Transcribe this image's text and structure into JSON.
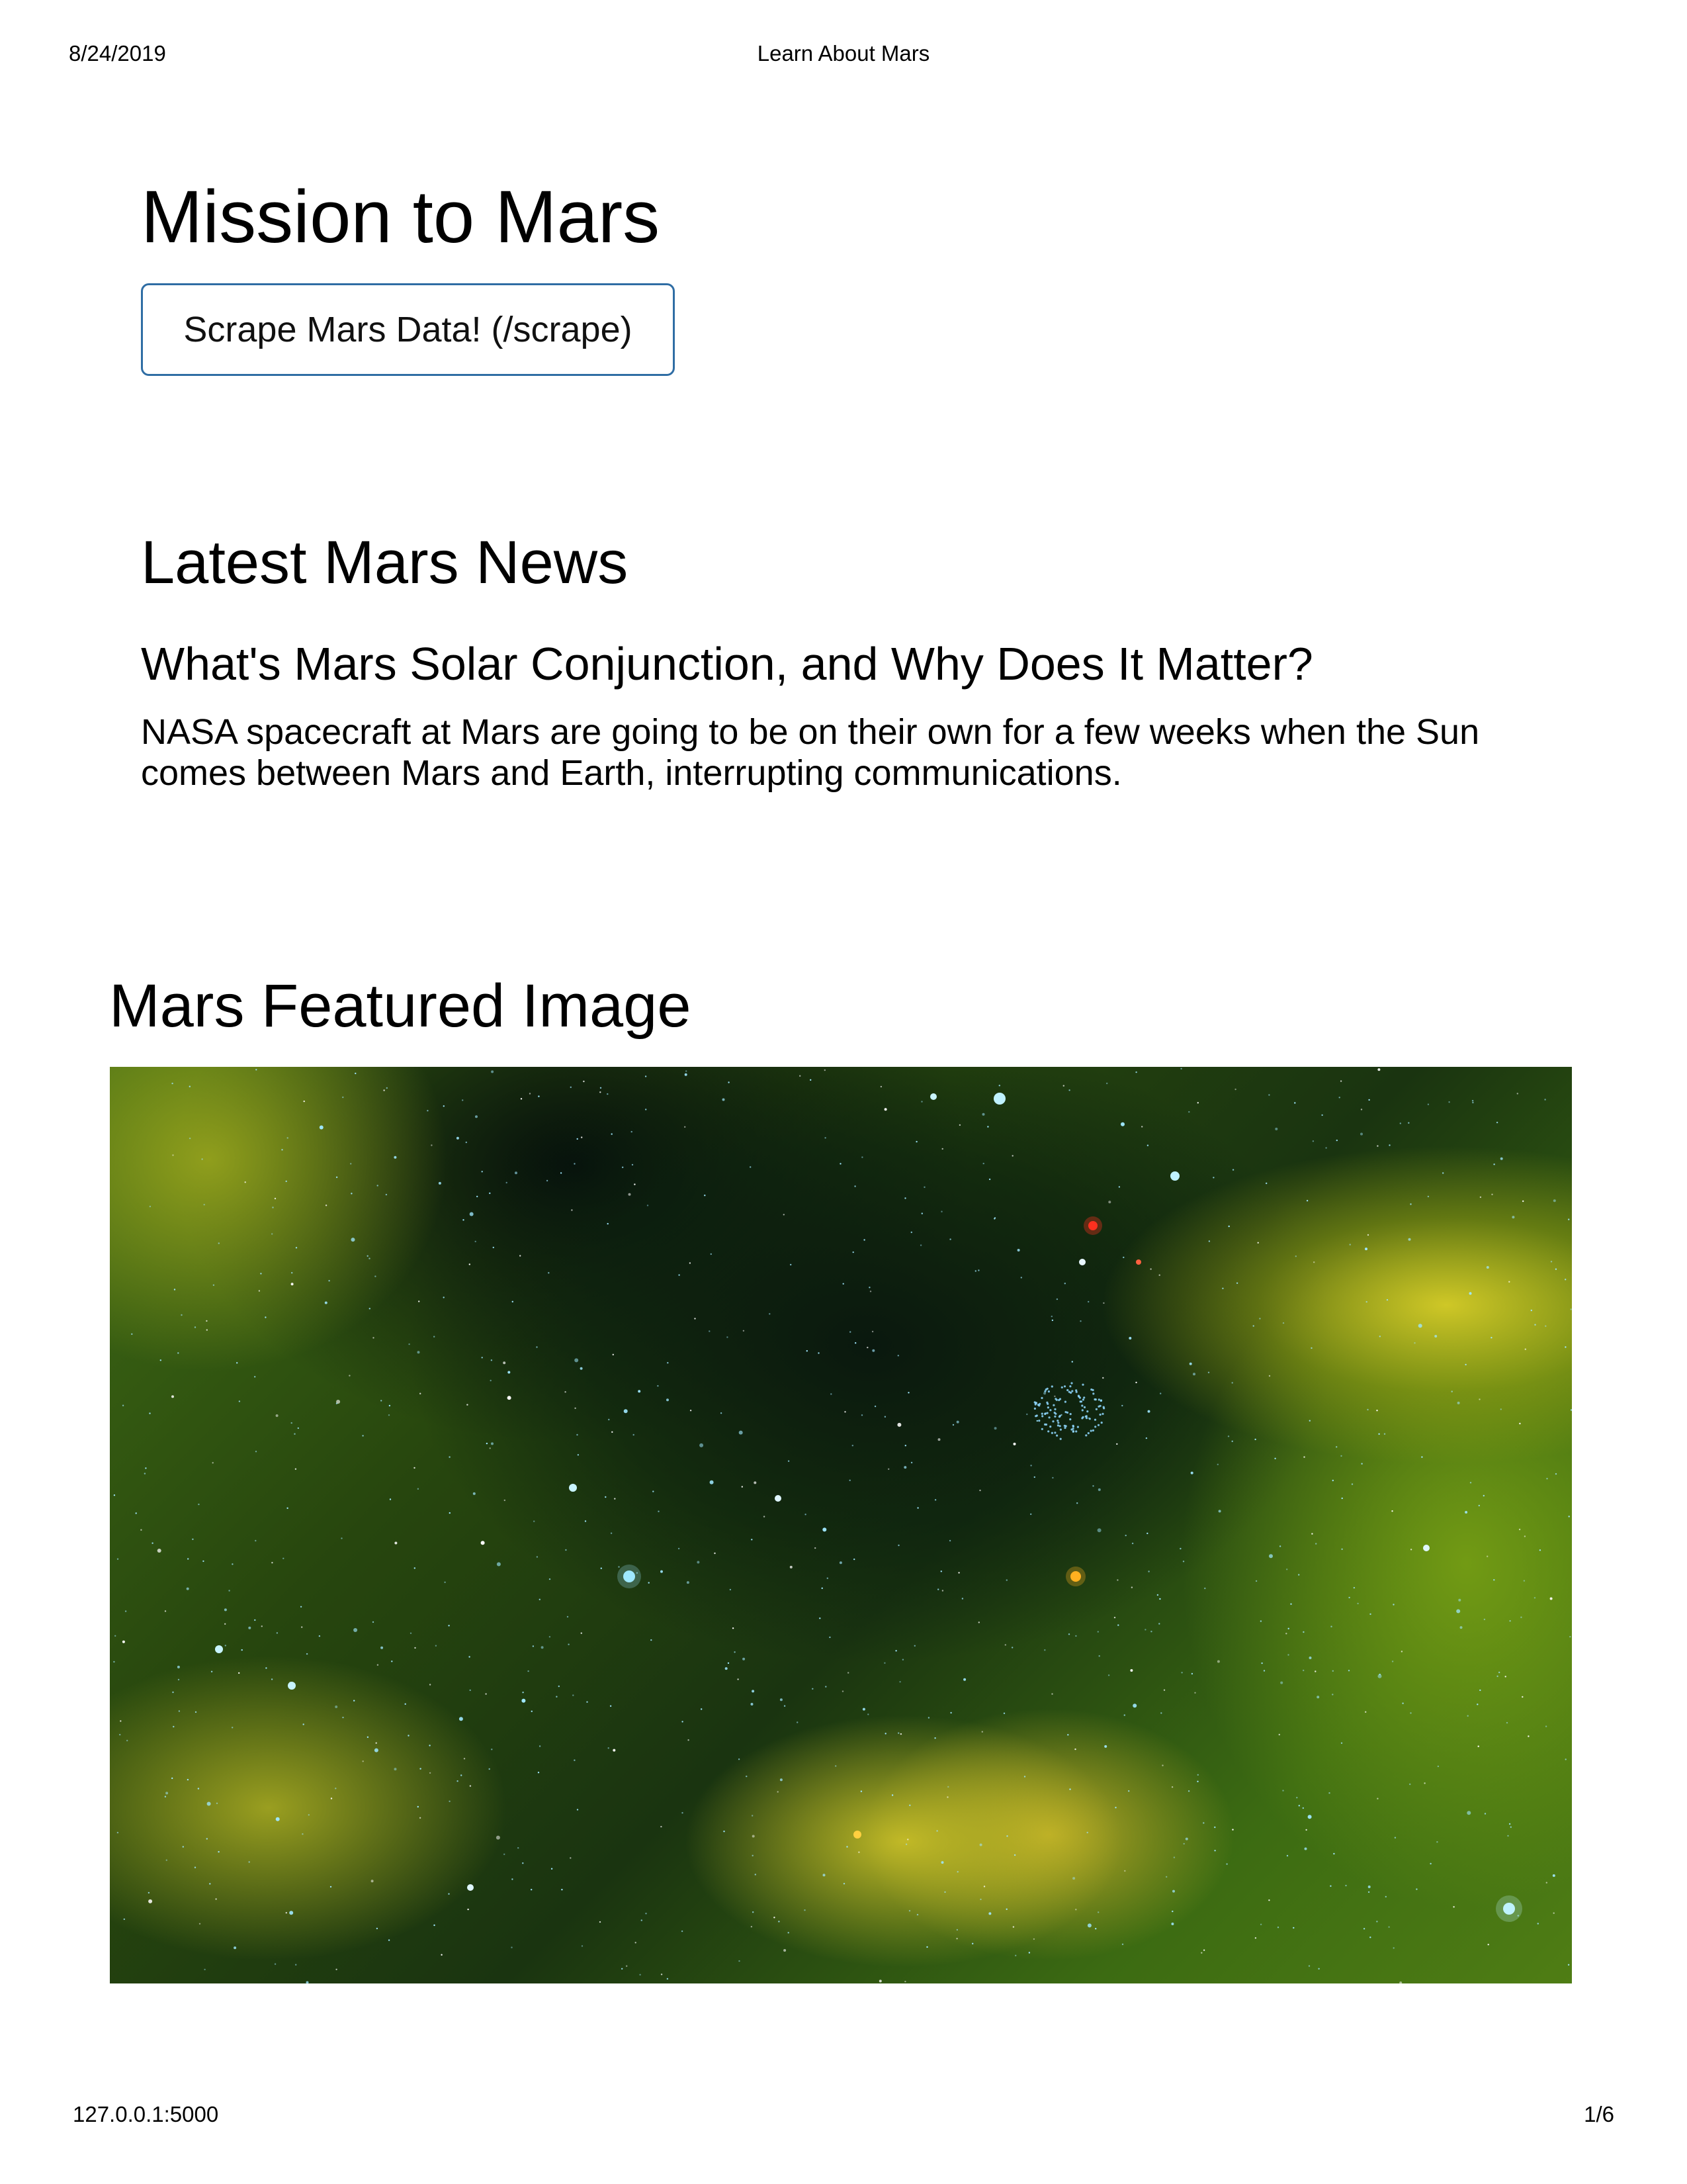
{
  "print_header": {
    "date": "8/24/2019",
    "title": "Learn About Mars"
  },
  "print_footer": {
    "url": "127.0.0.1:5000",
    "page": "1/6"
  },
  "jumbotron": {
    "title": "Mission to Mars",
    "button_label": "Scrape Mars Data! (/scrape)"
  },
  "news": {
    "heading": "Latest Mars News",
    "title": "What's Mars Solar Conjunction, and Why Does It Matter?",
    "paragraph": "NASA spacecraft at Mars are going to be on their own for a few weeks when the Sun comes between Mars and Earth, interrupting communications."
  },
  "featured": {
    "heading": "Mars Featured Image"
  },
  "colors": {
    "button_border": "#2f6da4",
    "nebula_green": "#3f6a14",
    "nebula_yellow": "#d7cd28",
    "star_cyan": "#9fe8ff",
    "star_red": "#ff3020"
  }
}
